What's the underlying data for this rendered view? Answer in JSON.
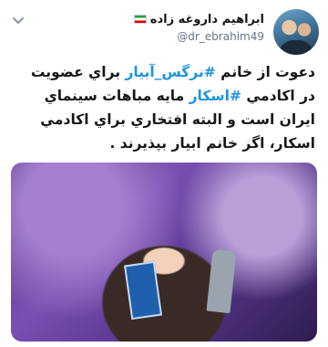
{
  "tweet": {
    "author": {
      "display_name": "ابراهیم داروغه زاده",
      "flag_icon": "iran-flag-icon",
      "handle": "@dr_ebrahim49"
    },
    "menu_icon": "chevron-down-icon",
    "text": {
      "line1_prefix": "دعوت از خانم ",
      "hashtag1": "#نرگس_آبيار",
      "line1_suffix": " براي عضويت",
      "line2_prefix": "در اكادمي ",
      "hashtag2": "#اسكار",
      "line2_suffix": " مايه مباهات سينماي",
      "line3": "ايران است و البته افتخاري براي اكادمي",
      "line4": "اسكار، اگر خانم ابيار بپذيرند ."
    },
    "colors": {
      "link": "#1b95e0",
      "text": "#14171a",
      "secondary": "#657786"
    }
  }
}
